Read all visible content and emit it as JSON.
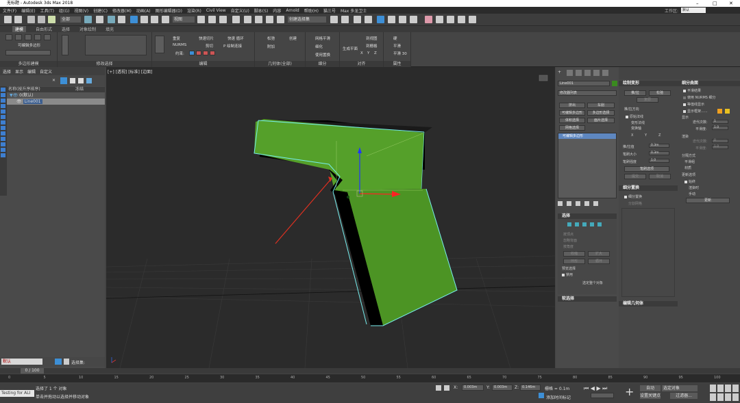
{
  "window": {
    "title": "无标题 - Autodesk 3ds Max 2018",
    "controls": [
      "–",
      "□",
      "✕"
    ]
  },
  "menu": [
    "文件(F)",
    "编辑(E)",
    "工具(T)",
    "组(G)",
    "视图(V)",
    "创建(C)",
    "修改器(M)",
    "动画(A)",
    "图形编辑器(D)",
    "渲染(R)",
    "Civil View",
    "自定义(U)",
    "脚本(S)",
    "内容",
    "Arnold",
    "帮助(H)",
    "猫三号",
    "Max 多龙卫士"
  ],
  "menu_right": {
    "workspace": "默认",
    "workspace_label": "工作区:"
  },
  "toolbar": {
    "filter": "全部",
    "view": "视图",
    "selset": "创建选择集"
  },
  "ribbon_tabs": [
    "建模",
    "自由形式",
    "选择",
    "对象绘制",
    "填充"
  ],
  "ribbon": {
    "polymod": "可编辑多边形",
    "sections": [
      "多边形建模",
      "修改选择",
      "编辑",
      "几何体(全部)",
      "细分",
      "对齐",
      "属性"
    ],
    "edit_items": [
      "重复",
      "快速切片",
      "快速 循环",
      "NURMS",
      "剪切",
      "P 绘制连接",
      "约束:"
    ],
    "geo_items": [
      "松弛",
      "创建",
      "附加"
    ],
    "subd_items": [
      "网格平滑",
      "细化",
      "使用置换"
    ],
    "align_items": [
      "生成平面",
      "到视图",
      "到栅格",
      "X",
      "Y",
      "Z"
    ],
    "prop_items": [
      "硬",
      "平滑",
      "平滑 30"
    ]
  },
  "left_menu": [
    "选择",
    "显示",
    "编辑",
    "自定义"
  ],
  "scene": {
    "header": "名称(按升序排序)",
    "col2": "冻结",
    "rows": [
      "0(默认)",
      "Line001"
    ]
  },
  "viewport": {
    "label": "[+] [透视] [标准] [边面]"
  },
  "cmd": {
    "object_name": "Line001",
    "modlist": "修改器列表",
    "buttons": [
      "挤出",
      "车削",
      "可编辑多边形",
      "多边形选择",
      "体积选择",
      "面片选择",
      "网格选择"
    ],
    "stack_item": "可编辑多边形"
  },
  "selection": {
    "title": "选择",
    "options": [
      "按顶点",
      "忽略背面",
      "按角度",
      "收缩",
      "扩大",
      "环形",
      "循环"
    ],
    "preview": "预览选择",
    "off": "禁用",
    "whole": "选定整个对象"
  },
  "softsel": {
    "title": "软选择"
  },
  "paint": {
    "title": "绘制变形",
    "push": "推/拉",
    "relax": "松弛",
    "revert": "复原",
    "dir": "推/拉方向",
    "dir_options": [
      "原始法线",
      "变形法线",
      "变换轴"
    ],
    "axes": [
      "X",
      "Y",
      "Z"
    ],
    "fields": [
      {
        "label": "推/拉值",
        "value": "0.3m"
      },
      {
        "label": "笔刷大小",
        "value": "0.3m"
      },
      {
        "label": "笔刷强度",
        "value": "1.0"
      }
    ],
    "opts": "笔刷选项",
    "commit": "提交",
    "cancel": "取消"
  },
  "subdsurf": {
    "title": "细分曲面",
    "smooth": "平滑结果",
    "nurms": "使用 NURMS 细分",
    "isoline": "等值线显示",
    "showcage": "显示框架......",
    "display": "显示",
    "iter": "迭代次数:",
    "iter_val": "1",
    "smoothness": "平滑度:",
    "smooth_val": "1.0",
    "render": "渲染",
    "iter2_val": "0",
    "smooth2_val": "1.0",
    "sep": "分隔方式",
    "sep1": "平滑组",
    "sep2": "材质",
    "update": "更新选项",
    "upd_opts": [
      "始终",
      "渲染时",
      "手动"
    ],
    "update_btn": "更新"
  },
  "subdisp": {
    "title": "细分置换",
    "item": "细分置换",
    "split": "分割网格"
  },
  "editgeo": {
    "title": "编辑几何体"
  },
  "bottom": {
    "layer": "默认",
    "selset": "选择集:",
    "frame": "0 / 100",
    "status1": "选择了 1 个 对象",
    "status2": "单击并拖动以选择并移动对象",
    "x": "0.003m",
    "y": "0.003m",
    "z": "0.146m",
    "grid": "栅格 = 0.1m",
    "addkey": "添加时间标记",
    "auto": "自动",
    "selected": "选定对象",
    "setkey": "设置关键点",
    "filter": "过滤器...",
    "script": "Testing for ALI",
    "ticks": [
      "0",
      "5",
      "10",
      "15",
      "20",
      "25",
      "30",
      "35",
      "40",
      "45",
      "50",
      "55",
      "60",
      "65",
      "70",
      "75",
      "80",
      "85",
      "90",
      "95",
      "100"
    ]
  }
}
